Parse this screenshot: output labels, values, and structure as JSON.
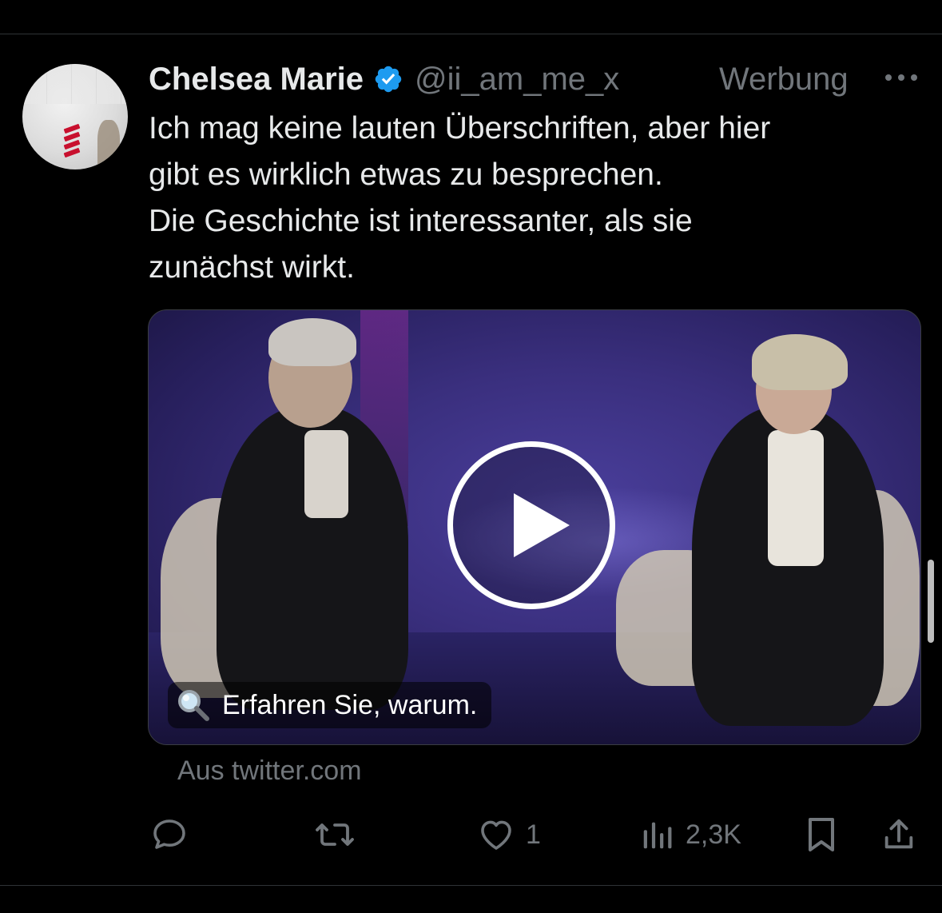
{
  "tweet": {
    "author_name": "Chelsea Marie",
    "handle": "@ii_am_me_x",
    "ad_label": "Werbung",
    "text_lines": [
      "Ich mag keine lauten Überschriften, aber hier",
      "gibt es wirklich etwas zu besprechen.",
      "Die Geschichte ist interessanter, als sie",
      "zunächst wirkt."
    ],
    "media": {
      "cta_text": "Erfahren Sie, warum."
    },
    "source_text": "Aus twitter.com",
    "actions": {
      "like_count": "1",
      "views_count": "2,3K"
    }
  },
  "icons": {
    "verified": "verified-badge-icon",
    "more": "more-icon",
    "play": "play-icon",
    "magnifier": "magnifying-glass-icon",
    "reply": "reply-icon",
    "retweet": "retweet-icon",
    "like": "heart-icon",
    "views": "views-icon",
    "bookmark": "bookmark-icon",
    "share": "share-icon"
  },
  "colors": {
    "background": "#000000",
    "text": "#e7e9ea",
    "secondary": "#71767b",
    "verified": "#1d9bf0"
  }
}
